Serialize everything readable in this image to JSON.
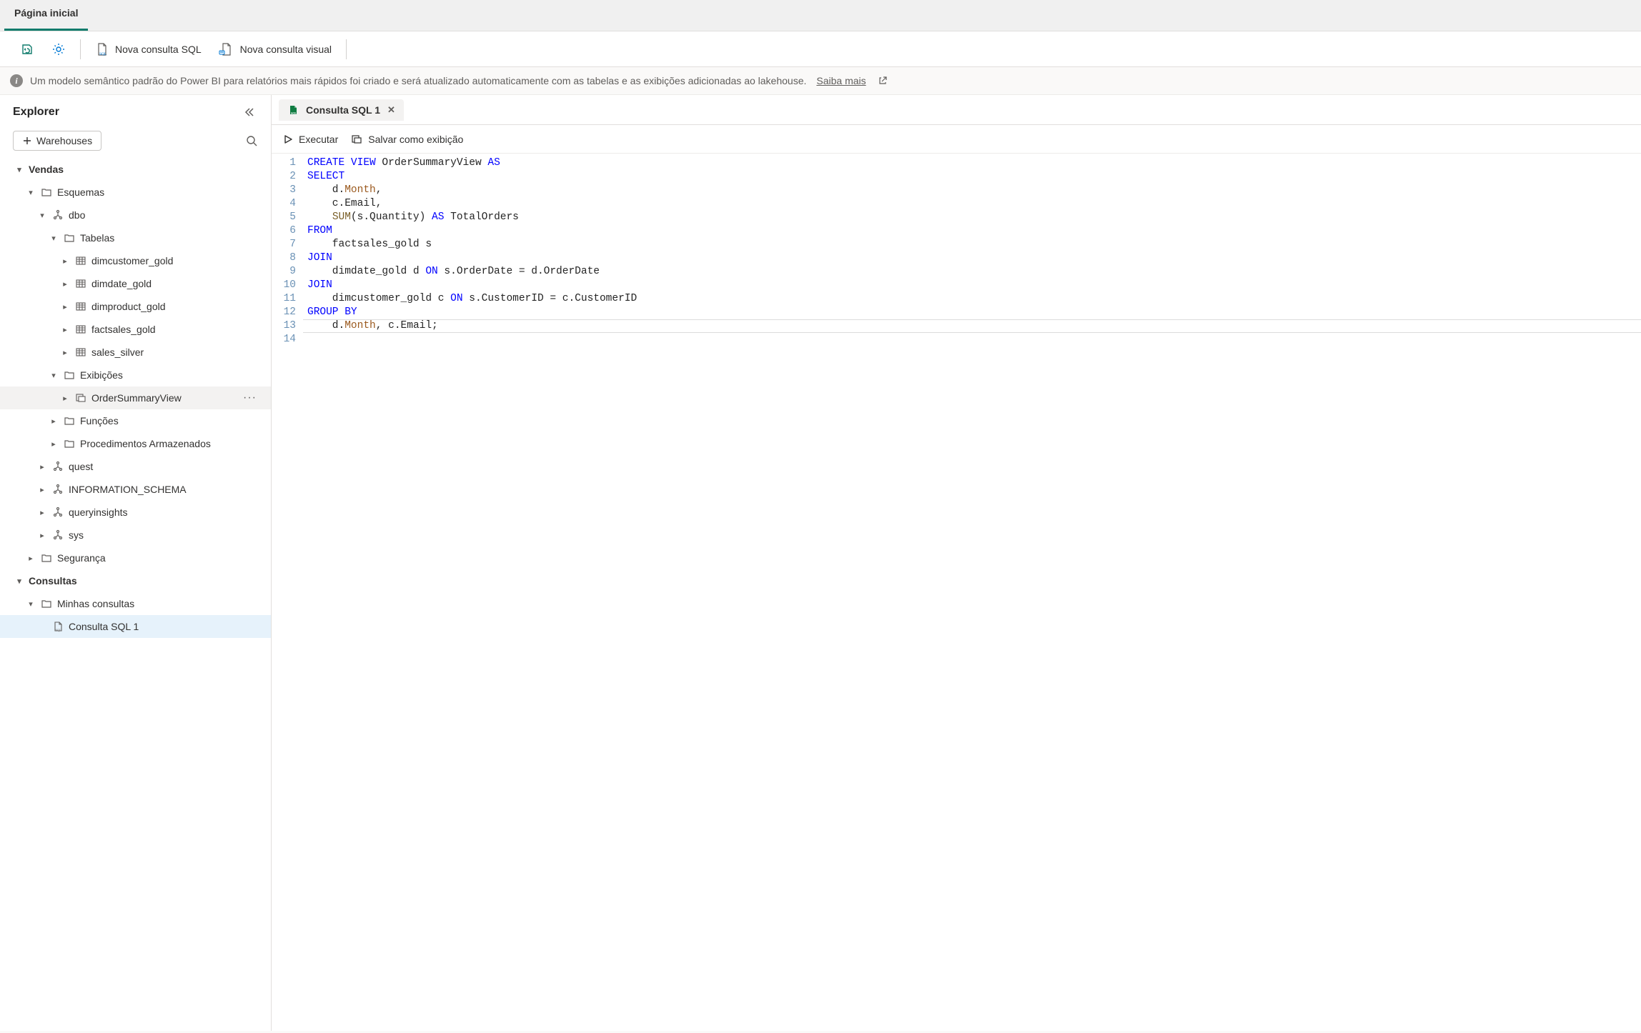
{
  "pageTabs": {
    "home": "Página inicial"
  },
  "toolbar": {
    "newSqlQuery": "Nova consulta SQL",
    "newVisualQuery": "Nova consulta visual"
  },
  "banner": {
    "text": "Um modelo semântico padrão do Power BI para relatórios mais rápidos foi criado e será atualizado automaticamente com as tabelas e as exibições adicionadas ao lakehouse.",
    "learnMore": "Saiba mais"
  },
  "explorer": {
    "title": "Explorer",
    "warehouses": "Warehouses",
    "tree": {
      "vendas": "Vendas",
      "esquemas": "Esquemas",
      "dbo": "dbo",
      "tabelas": "Tabelas",
      "tables": {
        "dimcustomer": "dimcustomer_gold",
        "dimdate": "dimdate_gold",
        "dimproduct": "dimproduct_gold",
        "factsales": "factsales_gold",
        "salessilver": "sales_silver"
      },
      "exibicoes": "Exibições",
      "views": {
        "orderSummary": "OrderSummaryView"
      },
      "funcoes": "Funções",
      "procedimentos": "Procedimentos Armazenados",
      "quest": "quest",
      "informationSchema": "INFORMATION_SCHEMA",
      "queryinsights": "queryinsights",
      "sys": "sys",
      "seguranca": "Segurança",
      "consultas": "Consultas",
      "minhasConsultas": "Minhas consultas",
      "queries": {
        "sql1": "Consulta SQL 1"
      }
    }
  },
  "editor": {
    "tabLabel": "Consulta SQL 1",
    "run": "Executar",
    "saveAsView": "Salvar como exibição",
    "code": {
      "l1": "CREATE VIEW OrderSummaryView AS",
      "l2": "SELECT",
      "l3": "    d.Month,",
      "l4": "    c.Email,",
      "l5": "    SUM(s.Quantity) AS TotalOrders",
      "l6": "FROM",
      "l7": "    factsales_gold s",
      "l8": "JOIN",
      "l9": "    dimdate_gold d ON s.OrderDate = d.OrderDate",
      "l10": "JOIN",
      "l11": "    dimcustomer_gold c ON s.CustomerID = c.CustomerID",
      "l12": "GROUP BY",
      "l13": "    d.Month, c.Email;",
      "l14": ""
    },
    "lineNumbers": [
      "1",
      "2",
      "3",
      "4",
      "5",
      "6",
      "7",
      "8",
      "9",
      "10",
      "11",
      "12",
      "13",
      "14"
    ]
  }
}
